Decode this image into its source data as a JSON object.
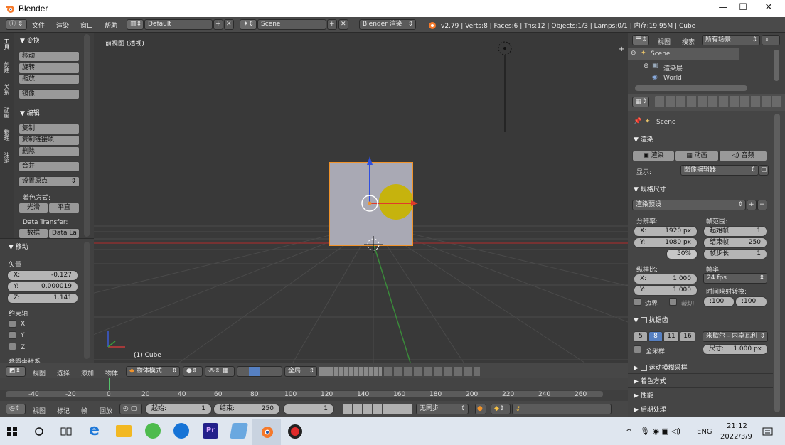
{
  "window": {
    "title": "Blender",
    "minimize": "—",
    "maximize": "☐",
    "close": "✕"
  },
  "topbar": {
    "menus": [
      "文件",
      "渲染",
      "窗口",
      "帮助"
    ],
    "layout": "Default",
    "scene": "Scene",
    "engine": "Blender 渲染",
    "stats": "v2.79 | Verts:8 | Faces:6 | Tris:12 | Objects:1/3 | Lamps:0/1 | 内存:19.95M | Cube"
  },
  "tool_shelf": {
    "tabs": [
      "工具",
      "创建",
      "关系",
      "动画",
      "物理",
      "油笔",
      "Grease"
    ],
    "transform_header": "变换",
    "transform_buttons": [
      "移动",
      "旋转",
      "缩放"
    ],
    "mirror": "镜像",
    "edit_header": "编辑",
    "edit_buttons": [
      "复制",
      "复制链接项",
      "删除"
    ],
    "join": "合并",
    "set_origin": "设置原点",
    "shading_label": "着色方式:",
    "smooth": "光滑",
    "flat": "平直",
    "data_transfer": "Data Transfer:",
    "data": "数据",
    "data_la": "Data La"
  },
  "operator_panel": {
    "header": "移动",
    "vector_label": "矢量",
    "x_label": "X:",
    "x": "-0.127",
    "y_label": "Y:",
    "y": "0.000019",
    "z_label": "Z:",
    "z": "1.141",
    "constraint_label": "约束轴",
    "axes": [
      "X",
      "Y",
      "Z"
    ],
    "orientation_partial": "参照坐标系"
  },
  "viewport": {
    "title": "前视图 (透视)",
    "object_label": "(1) Cube"
  },
  "outliner": {
    "view": "视图",
    "search": "搜索",
    "filter": "所有场景",
    "items": [
      "Scene",
      "渲染层",
      "World"
    ]
  },
  "properties": {
    "scene": "Scene",
    "render_header": "渲染",
    "render_btn": "渲染",
    "anim_btn": "动画",
    "audio_btn": "音频",
    "display_label": "显示:",
    "display_value": "图像编辑器",
    "dimensions_header": "规格尺寸",
    "preset": "渲染预设",
    "resolution_label": "分辨率:",
    "frame_range_label": "帧范围:",
    "res_x_label": "X:",
    "res_x": "1920 px",
    "res_y_label": "Y:",
    "res_y": "1080 px",
    "res_pct": "50%",
    "start_label": "起始帧:",
    "start": "1",
    "end_label": "结束帧:",
    "end": "250",
    "step_label": "帧步长:",
    "step": "1",
    "aspect_label": "纵横比:",
    "fps_label": "帧率:",
    "asp_x_label": "X:",
    "asp_x": "1.000",
    "asp_y_label": "Y:",
    "asp_y": "1.000",
    "fps": "24 fps",
    "time_remap_label": "时间映射转换:",
    "remap_old": ":100",
    "remap_new": ":100",
    "border": "边界",
    "crop": "裁切",
    "aa_header": "抗锯齿",
    "aa_samples": [
      "5",
      "8",
      "11",
      "16"
    ],
    "aa_filter": "米歇尔 - 内卓瓦利",
    "full_sample": "全采样",
    "size_label": "尺寸:",
    "size": "1.000 px",
    "motion_blur": "运动模糊采样",
    "shading": "着色方式",
    "performance": "性能",
    "post": "后期处理"
  },
  "view_header": {
    "view": "视图",
    "select": "选择",
    "add": "添加",
    "object": "物体",
    "mode": "物体模式",
    "global": "全局"
  },
  "timeline": {
    "ticks": [
      "-40",
      "-20",
      "0",
      "20",
      "40",
      "60",
      "80",
      "100",
      "120",
      "140",
      "160",
      "180",
      "200",
      "220",
      "240",
      "260"
    ],
    "view": "视图",
    "marker": "标记",
    "frame": "帧",
    "playback": "回放",
    "start_label": "起始:",
    "start": "1",
    "end_label": "结束:",
    "end": "250",
    "current": "1",
    "sync": "无同步"
  },
  "taskbar": {
    "lang": "ENG",
    "time": "21:12",
    "date": "2022/3/9"
  },
  "colors": {
    "accent": "#5680c2",
    "selected_outline": "#f0932b",
    "x_axis": "#c83a3a",
    "y_axis": "#3aa03a",
    "z_axis": "#3a5cd8"
  }
}
